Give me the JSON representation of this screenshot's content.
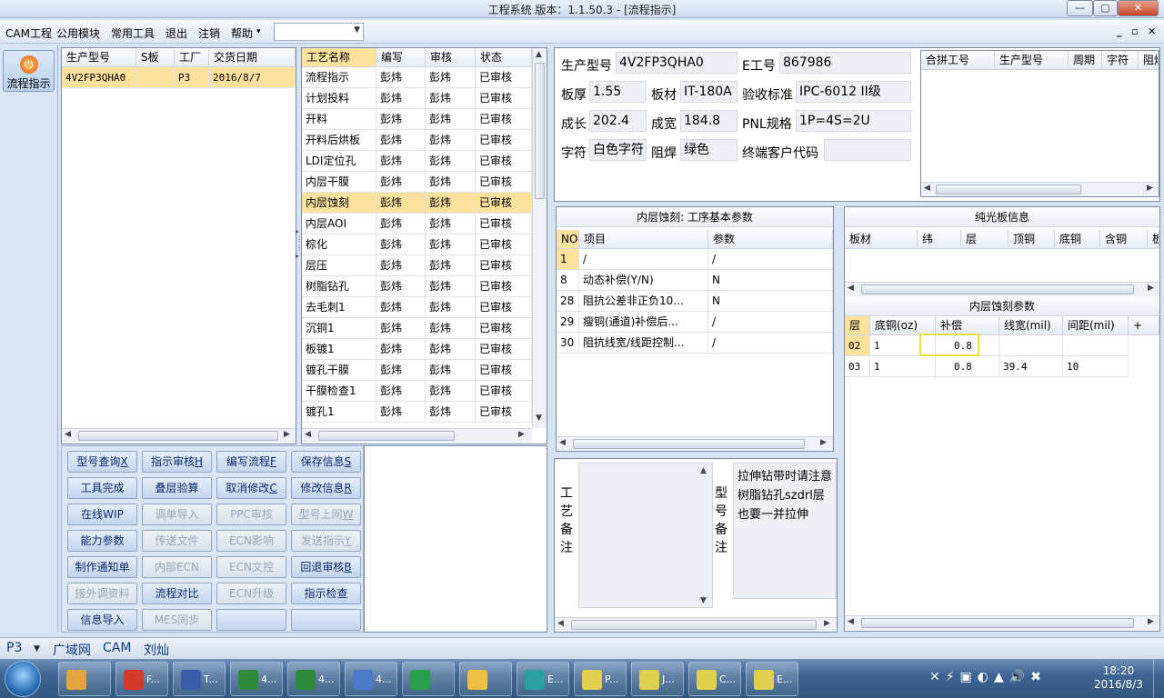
{
  "window": {
    "title": "工程系统   版本：1.1.50.3 - [流程指示]",
    "min": "—",
    "max": "▢",
    "close": "✕"
  },
  "menu": {
    "items": [
      "CAM工程",
      "公用模块",
      "常用工具",
      "退出",
      "注销",
      "帮助"
    ],
    "combo_value": "",
    "mdi": [
      "_",
      "▫",
      "✕"
    ]
  },
  "nav": {
    "flow_label": "流程指示"
  },
  "orders": {
    "headers": [
      "生产型号",
      "S板",
      "工厂",
      "交货日期"
    ],
    "rows": [
      {
        "model": "4V2FP3QHA0",
        "s": "",
        "factory": "P3",
        "date": "2016/8/7"
      }
    ]
  },
  "processes": {
    "headers": [
      "工艺名称",
      "编写",
      "审核",
      "状态"
    ],
    "selected_index": 6,
    "rows": [
      [
        "流程指示",
        "彭炜",
        "彭炜",
        "已审核"
      ],
      [
        "计划投料",
        "彭炜",
        "彭炜",
        "已审核"
      ],
      [
        "开料",
        "彭炜",
        "彭炜",
        "已审核"
      ],
      [
        "开料后烘板",
        "彭炜",
        "彭炜",
        "已审核"
      ],
      [
        "LDI定位孔",
        "彭炜",
        "彭炜",
        "已审核"
      ],
      [
        "内层干膜",
        "彭炜",
        "彭炜",
        "已审核"
      ],
      [
        "内层蚀刻",
        "彭炜",
        "彭炜",
        "已审核"
      ],
      [
        "内层AOI",
        "彭炜",
        "彭炜",
        "已审核"
      ],
      [
        "棕化",
        "彭炜",
        "彭炜",
        "已审核"
      ],
      [
        "层压",
        "彭炜",
        "彭炜",
        "已审核"
      ],
      [
        "树脂钻孔",
        "彭炜",
        "彭炜",
        "已审核"
      ],
      [
        "去毛刺1",
        "彭炜",
        "彭炜",
        "已审核"
      ],
      [
        "沉铜1",
        "彭炜",
        "彭炜",
        "已审核"
      ],
      [
        "板镀1",
        "彭炜",
        "彭炜",
        "已审核"
      ],
      [
        "镀孔干膜",
        "彭炜",
        "彭炜",
        "已审核"
      ],
      [
        "干膜检查1",
        "彭炜",
        "彭炜",
        "已审核"
      ],
      [
        "镀孔1",
        "彭炜",
        "彭炜",
        "已审核"
      ]
    ]
  },
  "buttons": [
    {
      "label": "型号查询",
      "key": "X",
      "enabled": true
    },
    {
      "label": "指示审核",
      "key": "H",
      "enabled": true
    },
    {
      "label": "编写流程",
      "key": "F",
      "enabled": true
    },
    {
      "label": "保存信息",
      "key": "S",
      "enabled": true
    },
    {
      "label": "工具完成",
      "key": "",
      "enabled": true
    },
    {
      "label": "叠层验算",
      "key": "",
      "enabled": true
    },
    {
      "label": "取消修改",
      "key": "C",
      "enabled": true
    },
    {
      "label": "修改信息",
      "key": "R",
      "enabled": true
    },
    {
      "label": "在线WIP",
      "key": "",
      "enabled": true
    },
    {
      "label": "调单导入",
      "key": "",
      "enabled": false
    },
    {
      "label": "PPC审核",
      "key": "",
      "enabled": false
    },
    {
      "label": "型号上网",
      "key": "W",
      "enabled": false
    },
    {
      "label": "能力参数",
      "key": "",
      "enabled": true
    },
    {
      "label": "传送文件",
      "key": "",
      "enabled": false
    },
    {
      "label": "ECN影响",
      "key": "",
      "enabled": false
    },
    {
      "label": "发送指示",
      "key": "Y",
      "enabled": false
    },
    {
      "label": "制作通知单",
      "key": "",
      "enabled": true
    },
    {
      "label": "内部ECN",
      "key": "",
      "enabled": false
    },
    {
      "label": "ECN文控",
      "key": "",
      "enabled": false
    },
    {
      "label": "回退审核",
      "key": "B",
      "enabled": true
    },
    {
      "label": "接外调资料",
      "key": "",
      "enabled": false
    },
    {
      "label": "流程对比",
      "key": "",
      "enabled": true
    },
    {
      "label": "ECN升级",
      "key": "",
      "enabled": false
    },
    {
      "label": "指示检查",
      "key": "",
      "enabled": true
    },
    {
      "label": "信息导入",
      "key": "",
      "enabled": true
    },
    {
      "label": "MES同步",
      "key": "",
      "enabled": false
    },
    {
      "label": "",
      "key": "",
      "enabled": true
    },
    {
      "label": "",
      "key": "",
      "enabled": true
    }
  ],
  "info": {
    "model_label": "生产型号",
    "model": "4V2FP3QHA0",
    "eno_label": "E工号",
    "eno": "867986",
    "thick_label": "板厚",
    "thick": "1.55",
    "material_label": "板材",
    "material": "IT-180A",
    "std_label": "验收标准",
    "std": "IPC-6012 II级",
    "len_label": "成长",
    "len": "202.4",
    "wid_label": "成宽",
    "wid": "184.8",
    "pnl_label": "PNL规格",
    "pnl": "1P=4S=2U",
    "char_label": "字符",
    "char": "白色字符",
    "mask_label": "阻焊",
    "mask": "绿色",
    "cust_label": "终端客户代码",
    "cust": ""
  },
  "merge": {
    "headers": [
      "合拼工号",
      "生产型号",
      "周期",
      "字符",
      "阻焊"
    ]
  },
  "params": {
    "title": "内层蚀刻: 工序基本参数",
    "headers": [
      "NO",
      "项目",
      "参数"
    ],
    "rows": [
      [
        "1",
        "/",
        "/"
      ],
      [
        "8",
        "动态补偿(Y/N)",
        "N"
      ],
      [
        "28",
        "阻抗公差非正负10...",
        "N"
      ],
      [
        "29",
        "瘦铜(通道)补偿后...",
        "/"
      ],
      [
        "30",
        "阻抗线宽/线距控制...",
        "/"
      ]
    ]
  },
  "plain": {
    "title": "纯光板信息",
    "headers": [
      "板材",
      "纬",
      "层",
      "顶铜",
      "底铜",
      "含铜",
      "板"
    ]
  },
  "etch": {
    "title": "内层蚀刻参数",
    "headers": [
      "层",
      "底铜(oz)",
      "补偿",
      "线宽(mil)",
      "间距(mil)",
      "+"
    ],
    "rows": [
      [
        "02",
        "1",
        "0.8",
        "",
        ""
      ],
      [
        "03",
        "1",
        "0.8",
        "39.4",
        "10"
      ]
    ]
  },
  "notes": {
    "process_label": [
      "工",
      "艺",
      "备",
      "注"
    ],
    "model_label": [
      "型",
      "号",
      "备",
      "注"
    ],
    "model_note": "拉伸钻带时请注意树脂钻孔szdrl层也要一并拉伸"
  },
  "status": {
    "factory": "P3",
    "net": "广域网",
    "dept": "CAM",
    "user": "刘灿"
  },
  "taskbar": {
    "apps": [
      "F...",
      "T...",
      "4...",
      "4...",
      "4...",
      "",
      "",
      "E...",
      "P...",
      "J...",
      "C...",
      "E..."
    ],
    "time": "18:20",
    "date": "2016/8/3"
  }
}
